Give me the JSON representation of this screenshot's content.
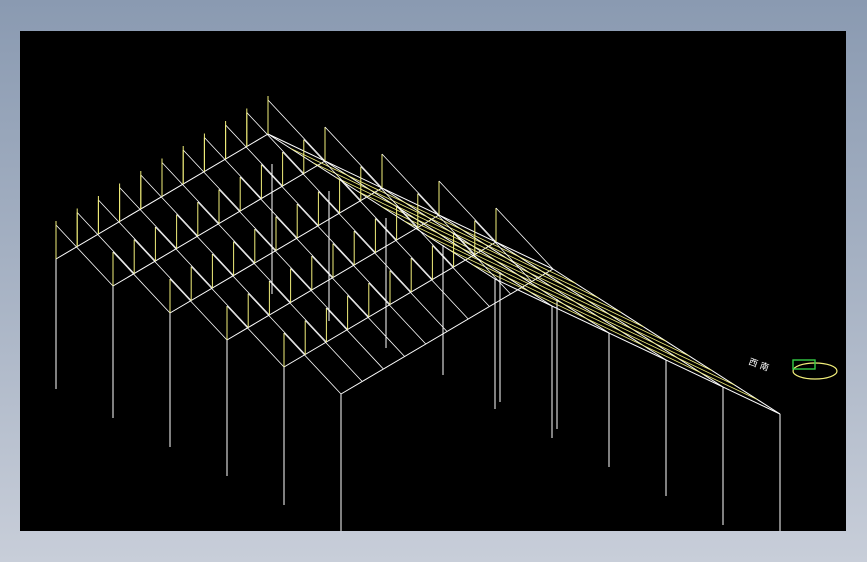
{
  "canvas": {
    "background": "#000000",
    "frame_gradient_top": "#8a9ab1",
    "frame_gradient_bottom": "#c8ced9"
  },
  "colors": {
    "frame_lines": "#ffffff",
    "purlins": "#f2ef7a",
    "compass_ring": "#f2ef7a",
    "compass_box": "#33cc44"
  },
  "diagram": {
    "description_type": "isometric steel portal-frame wireframe",
    "bays": 5,
    "roof": "gable"
  },
  "compass": {
    "icon": "view-cube-icon",
    "label_text": "西 南"
  }
}
